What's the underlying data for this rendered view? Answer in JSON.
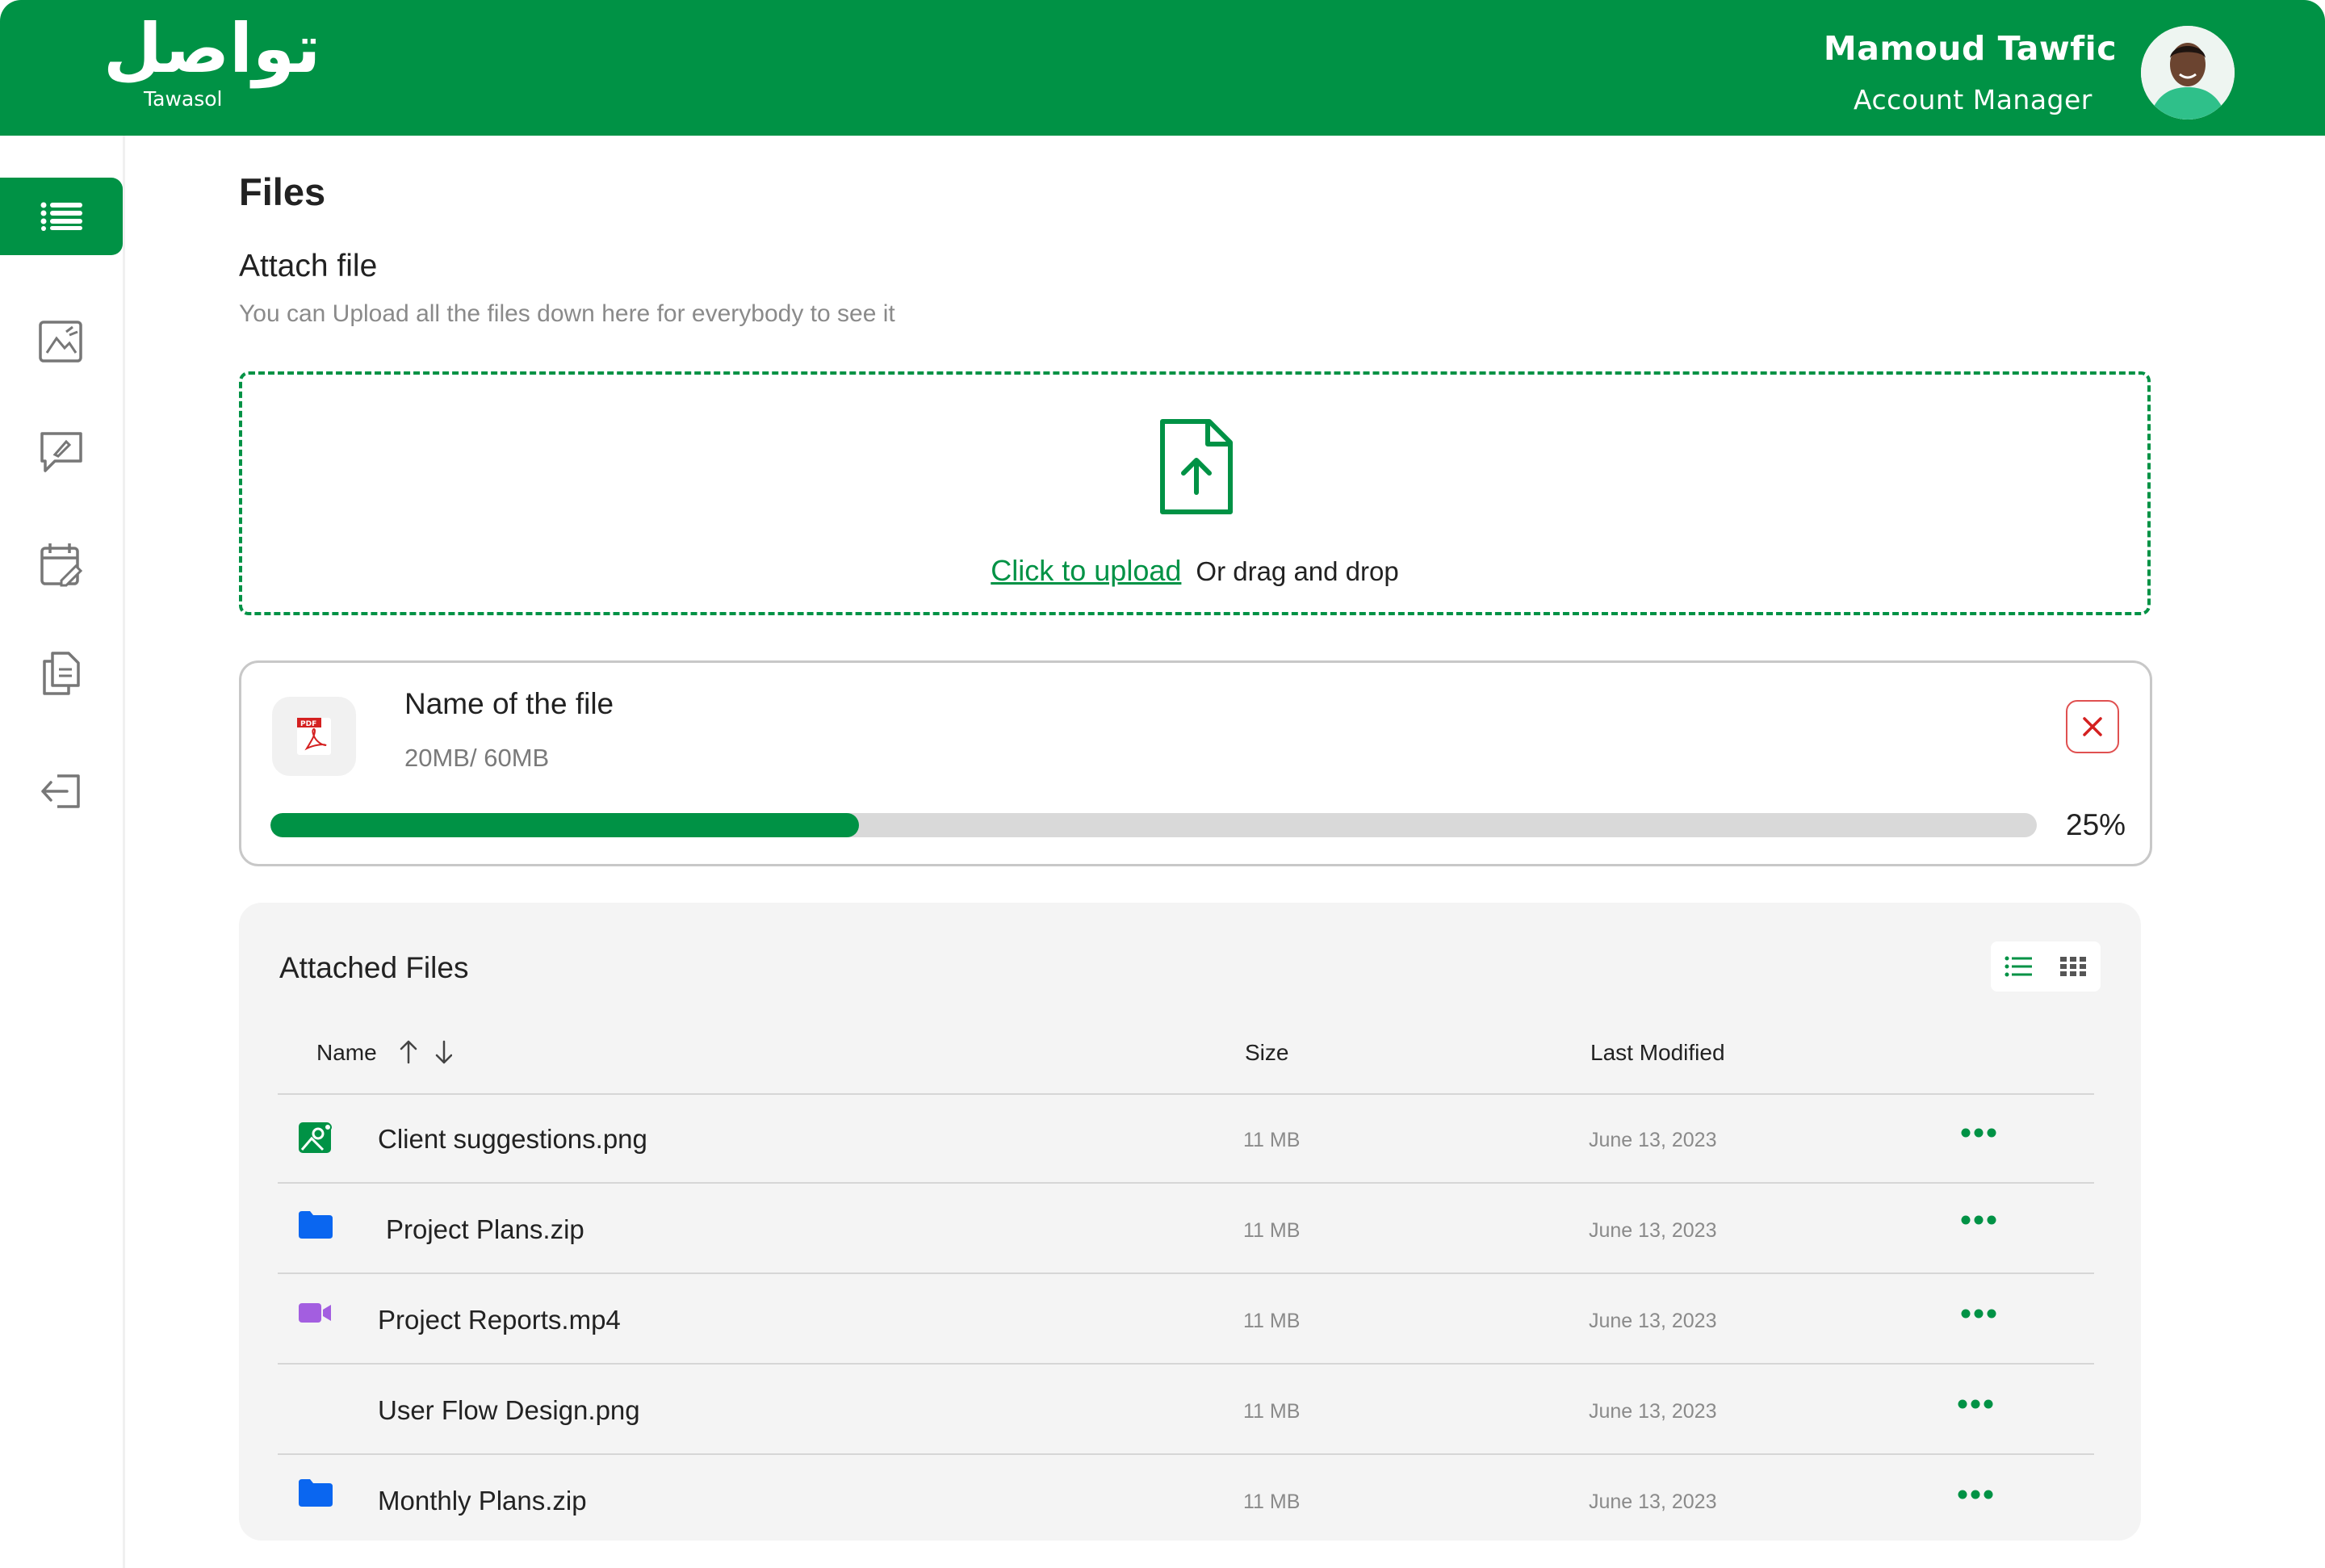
{
  "header": {
    "logo_arabic": "تواصل",
    "logo_english": "Tawasol",
    "user_name": "Mamoud Tawfic",
    "user_role": "Account Manager"
  },
  "sidebar": {
    "items": [
      {
        "icon": "list-icon",
        "active": true
      },
      {
        "icon": "image-edit-icon",
        "active": false
      },
      {
        "icon": "message-edit-icon",
        "active": false
      },
      {
        "icon": "calendar-edit-icon",
        "active": false
      },
      {
        "icon": "documents-icon",
        "active": false
      },
      {
        "icon": "logout-icon",
        "active": false
      }
    ]
  },
  "page": {
    "title": "Files",
    "attach_title": "Attach file",
    "attach_description": "You can Upload all the files down here for everybody to see it"
  },
  "dropzone": {
    "icon": "file-upload-icon",
    "link_label": "Click to upload",
    "rest_label": "Or drag and drop"
  },
  "upload": {
    "file_name": "Name of the file",
    "size_text": "20MB/ 60MB",
    "progress_label": "25%",
    "progress_fraction": 0.333,
    "file_icon": "pdf-icon"
  },
  "attached": {
    "title": "Attached Files",
    "columns": {
      "name": "Name",
      "size": "Size",
      "modified": "Last Modified"
    },
    "rows": [
      {
        "name": "Client suggestions.png",
        "size": "11 MB",
        "modified": "June 13, 2023",
        "icon": "image-file-icon",
        "icon_color": "#009245"
      },
      {
        "name": "Project Plans.zip",
        "size": "11 MB",
        "modified": "June 13, 2023",
        "icon": "folder-icon",
        "icon_color": "#0a66f0"
      },
      {
        "name": "Project Reports.mp4",
        "size": "11 MB",
        "modified": "June 13, 2023",
        "icon": "video-icon",
        "icon_color": "#a35ee0"
      },
      {
        "name": "User Flow Design.png",
        "size": "11 MB",
        "modified": "June 13, 2023",
        "icon": "",
        "icon_color": ""
      },
      {
        "name": "Monthly Plans.zip",
        "size": "11 MB",
        "modified": "June 13, 2023",
        "icon": "folder-icon",
        "icon_color": "#0a66f0"
      }
    ]
  },
  "colors": {
    "brand": "#009245",
    "danger": "#e05050",
    "folder": "#0a66f0",
    "video": "#a35ee0"
  }
}
